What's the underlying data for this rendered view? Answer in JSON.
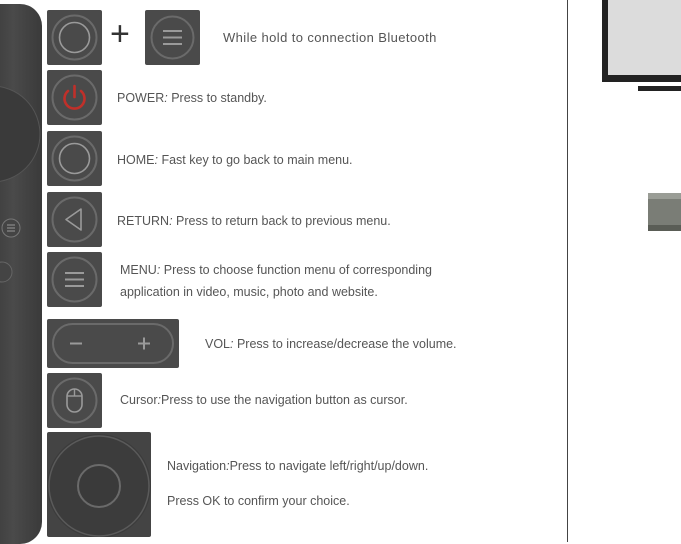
{
  "bluetooth": {
    "plus": "+",
    "text": "While hold  to connection Bluetooth"
  },
  "items": {
    "power": {
      "name": "POWER",
      "sep": ":",
      "desc": " Press to standby."
    },
    "home": {
      "name": "HOME",
      "sep": ":",
      "desc": " Fast key to go back to main menu."
    },
    "return": {
      "name": "RETURN",
      "sep": ":",
      "desc": " Press to return back to previous menu."
    },
    "menu": {
      "name": "MENU",
      "sep": ":",
      "desc": " Press to choose function menu of corresponding",
      "desc2": "application in video, music, photo and website."
    },
    "vol": {
      "name": "VOL",
      "sep": ":",
      "desc": " Press to increase/decrease the volume."
    },
    "cursor": {
      "name": "Cursor",
      "sep": ":",
      "desc": "Press  to  use the navigation button as cursor."
    },
    "navigation": {
      "name": "Navigation",
      "sep": ":",
      "desc": "Press to navigate left/right/up/down.",
      "desc2": "Press OK to confirm your choice."
    }
  },
  "colors": {
    "tile": "#4a4a4a",
    "power_red": "#c0302a",
    "icon_gray": "#8a8a8a",
    "text": "#555555"
  }
}
